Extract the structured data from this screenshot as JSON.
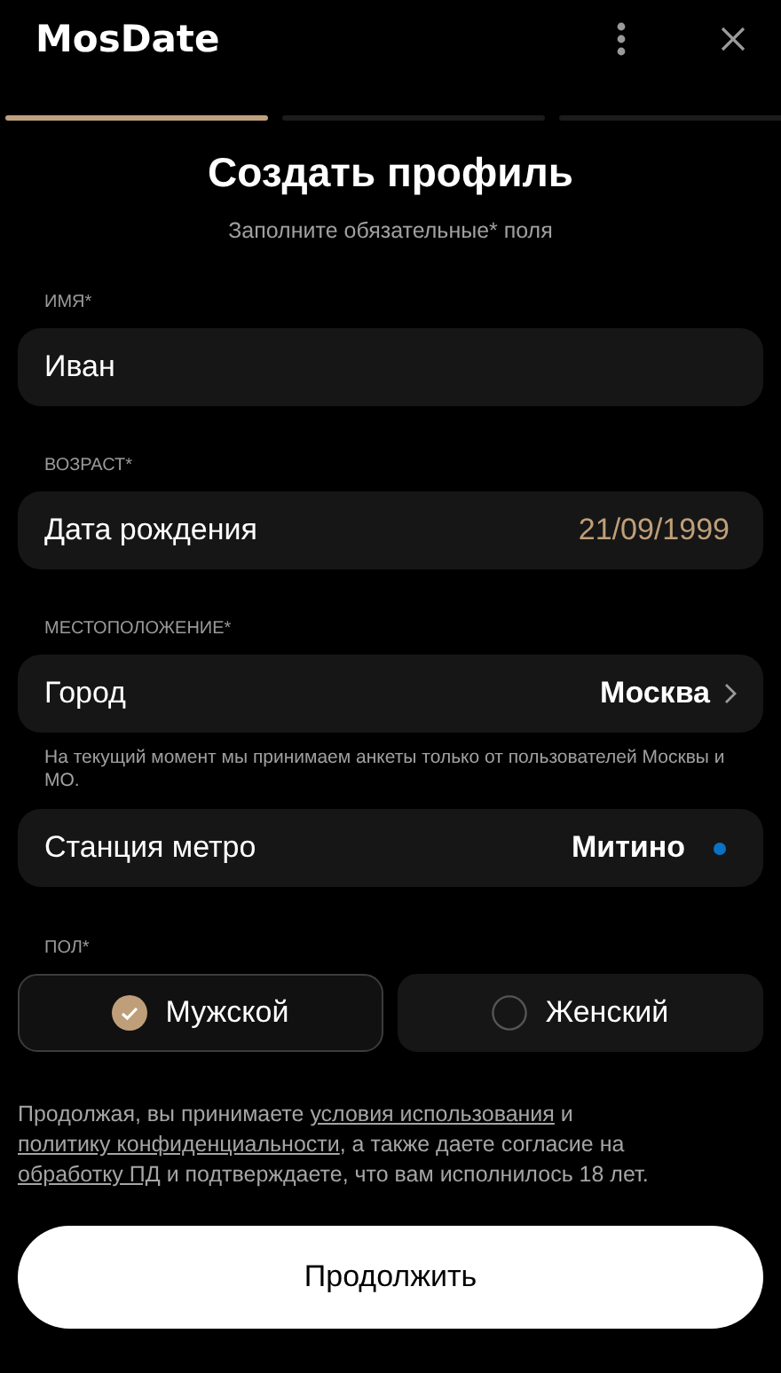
{
  "header": {
    "title": "MosDate"
  },
  "progress_steps": [
    {
      "done": true
    },
    {
      "done": false
    },
    {
      "done": false
    }
  ],
  "heading": "Создать профиль",
  "subtitle": "Заполните обязательные* поля",
  "sections": [
    {
      "label": "ИМЯ*",
      "fields": [
        {
          "kind": "text",
          "value": "Иван"
        }
      ]
    },
    {
      "label": "ВОЗРАСТ*",
      "fields": [
        {
          "kind": "date",
          "label": "Дата рождения",
          "value": "21/09/1999"
        }
      ]
    },
    {
      "label": "МЕСТОПОЛОЖЕНИЕ*",
      "fields": [
        {
          "kind": "select",
          "label": "Город",
          "value": "Москва"
        },
        {
          "kind": "note",
          "text": "На текущий момент мы принимаем анкеты только от пользователей Москвы и МО."
        },
        {
          "kind": "metro",
          "label": "Станция метро",
          "value": "Митино",
          "color": "#0a72c4"
        }
      ]
    }
  ],
  "gender": {
    "label": "ПОЛ*",
    "options": [
      {
        "label": "Мужской",
        "selected": true
      },
      {
        "label": "Женский",
        "selected": false
      }
    ]
  },
  "consent": [
    {
      "kind": "text",
      "text": "Продолжая, вы принимаете "
    },
    {
      "kind": "link",
      "text": "условия использования"
    },
    {
      "kind": "text",
      "text": " и "
    },
    {
      "kind": "link",
      "text": "политику конфиденциальности"
    },
    {
      "kind": "text",
      "text": ", а также даете согласие на "
    },
    {
      "kind": "link",
      "text": "обработку ПД"
    },
    {
      "kind": "text",
      "text": " и подтверждаете, что вам исполнилось 18 лет."
    }
  ],
  "continue_button": "Продолжить"
}
